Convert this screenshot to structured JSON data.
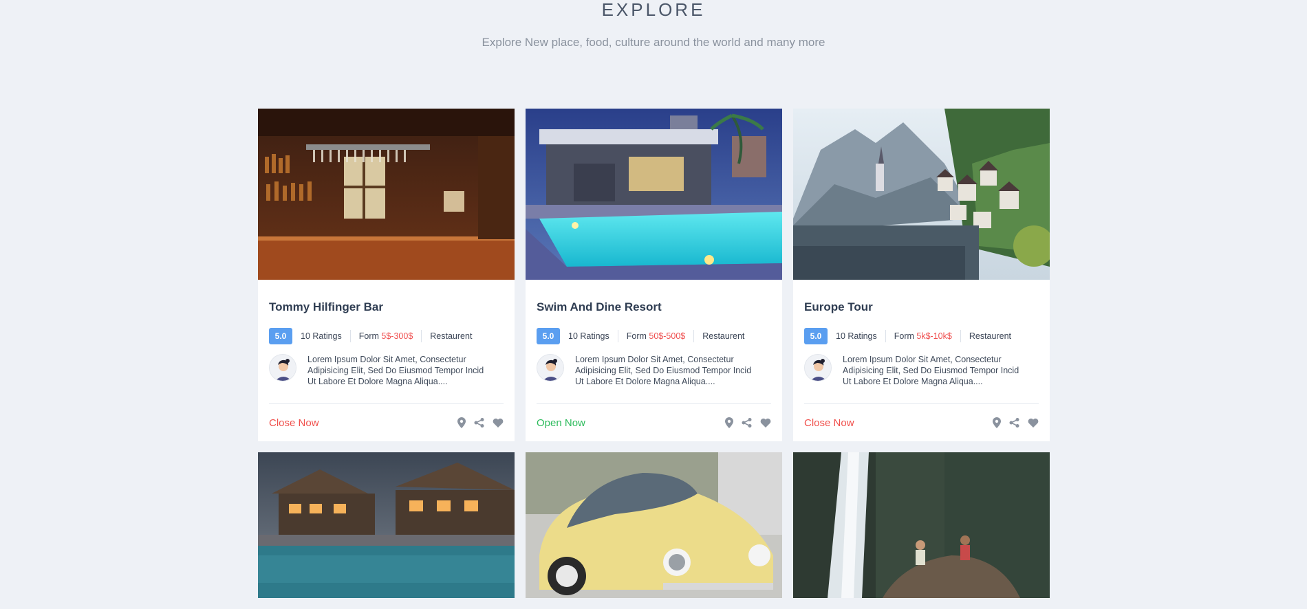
{
  "header": {
    "title": "EXPLORE",
    "subtitle": "Explore New place, food, culture around the world and many more"
  },
  "cards": [
    {
      "title": "Tommy Hilfinger Bar",
      "rating": "5.0",
      "ratings_text": "10 Ratings",
      "price_prefix": "Form ",
      "price": "5$-300$",
      "category": "Restaurent",
      "description": "Lorem Ipsum Dolor Sit Amet, Consectetur Adipisicing Elit, Sed Do Eiusmod Tempor Incid Ut Labore Et Dolore Magna Aliqua....",
      "status": "Close Now",
      "status_type": "closed",
      "image": "bar-interior"
    },
    {
      "title": "Swim And Dine Resort",
      "rating": "5.0",
      "ratings_text": "10 Ratings",
      "price_prefix": "Form ",
      "price": "50$-500$",
      "category": "Restaurent",
      "description": "Lorem Ipsum Dolor Sit Amet, Consectetur Adipisicing Elit, Sed Do Eiusmod Tempor Incid Ut Labore Et Dolore Magna Aliqua....",
      "status": "Open Now",
      "status_type": "open",
      "image": "pool-resort"
    },
    {
      "title": "Europe Tour",
      "rating": "5.0",
      "ratings_text": "10 Ratings",
      "price_prefix": "Form ",
      "price": "5k$-10k$",
      "category": "Restaurent",
      "description": "Lorem Ipsum Dolor Sit Amet, Consectetur Adipisicing Elit, Sed Do Eiusmod Tempor Incid Ut Labore Et Dolore Magna Aliqua....",
      "status": "Close Now",
      "status_type": "closed",
      "image": "lake-village"
    }
  ],
  "second_row_images": [
    "lodge-pool",
    "yellow-car",
    "waterfall"
  ],
  "icons": [
    "map-pin-icon",
    "share-icon",
    "heart-icon"
  ],
  "colors": {
    "accent_blue": "#5a9ef0",
    "closed_red": "#f0504c",
    "open_green": "#2dbb5c",
    "background": "#eef1f6"
  }
}
